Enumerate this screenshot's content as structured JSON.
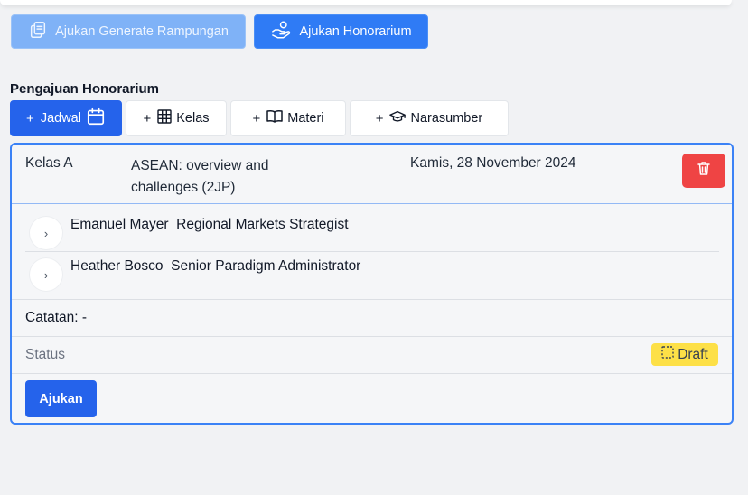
{
  "actions": {
    "generate_label": "Ajukan Generate Rampungan",
    "honorarium_label": "Ajukan Honorarium"
  },
  "section": {
    "title": "Pengajuan Honorarium"
  },
  "tabs": [
    {
      "label": "Jadwal",
      "icon": "calendar-icon",
      "active": true
    },
    {
      "label": "Kelas",
      "icon": "table-icon"
    },
    {
      "label": "Materi",
      "icon": "book-icon"
    },
    {
      "label": "Narasumber",
      "icon": "graduation-cap-icon"
    }
  ],
  "entry": {
    "kelas": "Kelas A",
    "materi": "ASEAN: overview and challenges  (2JP)",
    "tanggal": "Kamis, 28 November 2024",
    "narasumber": [
      {
        "name": "Emanuel Mayer  Regional Markets Strategist"
      },
      {
        "name": "Heather Bosco  Senior Paradigm Administrator"
      }
    ],
    "catatan": "Catatan: -",
    "status_label": "Status",
    "status_badge": "Draft",
    "submit_label": "Ajukan"
  },
  "colors": {
    "primary": "#2563eb",
    "primary_light": "#7fb2f7",
    "danger": "#ef4444",
    "draft_badge": "#fde047",
    "card_border": "#3b82f6"
  }
}
